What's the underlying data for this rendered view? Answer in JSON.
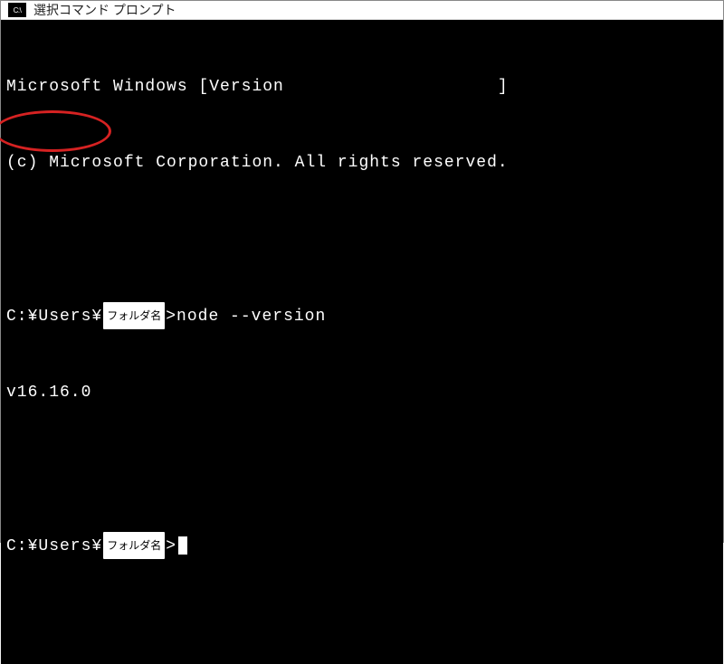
{
  "titlebar": {
    "icon_text": "C:\\",
    "title": "選択コマンド プロンプト"
  },
  "terminal": {
    "banner_line1_pre": "Microsoft Windows [Version",
    "banner_line1_post": "]",
    "banner_line2": "(c) Microsoft Corporation. All rights reserved.",
    "prompt1_prefix": "C:¥Users¥",
    "folder_placeholder": "フォルダ名",
    "prompt1_suffix": ">",
    "command1": "node --version",
    "output1": "v16.16.0",
    "prompt2_prefix": "C:¥Users¥",
    "prompt2_suffix": ">"
  },
  "annotation": {
    "circle_color": "#d62222"
  }
}
